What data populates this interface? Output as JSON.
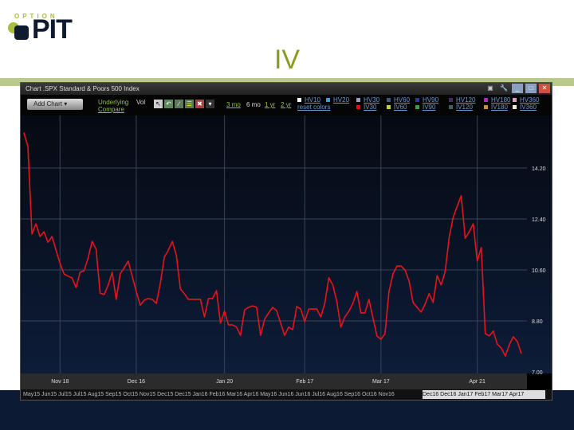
{
  "logo": {
    "top": "OPTION",
    "main": "PIT"
  },
  "slide_title": "IV",
  "window": {
    "title": "Chart  .SPX  Standard & Poors 500 Index",
    "buttons": [
      "camera",
      "wrench",
      "minimize",
      "maximize",
      "close"
    ],
    "add_chart": "Add Chart",
    "underlying": "Underlying",
    "vol": "Vol",
    "compare": "Compare",
    "ranges": [
      "3 mo",
      "6 mo",
      "1 yr",
      "2 yr"
    ],
    "legend_row1": [
      {
        "label": "HV10",
        "color": "#ffffff"
      },
      {
        "label": "HV20",
        "color": "#3aa0d0"
      },
      {
        "label": "HV30",
        "color": "#9aa0b8"
      },
      {
        "label": "HV60",
        "color": "#3a5a80"
      },
      {
        "label": "HV90",
        "color": "#3030c0"
      },
      {
        "label": "HV120",
        "color": "#403060"
      },
      {
        "label": "HV180",
        "color": "#c020c0"
      },
      {
        "label": "HV360",
        "color": "#e0a0c0"
      }
    ],
    "legend_row2": [
      {
        "label": "reset colors",
        "color": ""
      },
      {
        "label": "IV30",
        "color": "#e01010"
      },
      {
        "label": "IV60",
        "color": "#c0d040"
      },
      {
        "label": "IV90",
        "color": "#40a040"
      },
      {
        "label": "IV120",
        "color": "#406060"
      },
      {
        "label": "IV180",
        "color": "#d09030"
      },
      {
        "label": "IV360",
        "color": "#f0f0d0"
      }
    ],
    "navigator": "May15 Jun15 Jul15 Jul15 Aug15 Sep15 Oct15 Nov15 Dec15 Dec15 Jan16 Feb16 Mar16 Apr16 May16 Jun16 Jun16 Jul16 Aug16 Sep16 Oct16 Nov16",
    "navigator_selected": "Dec16 Dec16 Jan17 Feb17 Mar17 Apr17"
  },
  "chart_data": {
    "type": "line",
    "series": [
      {
        "name": "IV30",
        "color": "#e8141c",
        "values": [
          15.44,
          14.96,
          11.87,
          12.23,
          11.78,
          11.95,
          11.58,
          11.78,
          11.3,
          10.83,
          10.46,
          10.38,
          10.32,
          9.98,
          10.52,
          10.57,
          11.02,
          11.61,
          11.33,
          9.78,
          9.73,
          10.06,
          10.52,
          9.56,
          10.46,
          10.68,
          10.91,
          10.38,
          9.84,
          9.36,
          9.53,
          9.59,
          9.56,
          9.42,
          10.12,
          11.05,
          11.3,
          11.61,
          11.11,
          9.93,
          9.76,
          9.56,
          9.56,
          9.56,
          9.56,
          8.94,
          9.59,
          9.59,
          9.87,
          8.72,
          9.14,
          8.66,
          8.66,
          8.58,
          8.29,
          9.19,
          9.28,
          9.33,
          9.28,
          8.29,
          8.86,
          9.08,
          9.28,
          9.16,
          8.72,
          8.29,
          8.58,
          8.49,
          9.31,
          9.22,
          8.77,
          9.22,
          9.22,
          9.22,
          8.94,
          9.42,
          10.32,
          10.07,
          9.48,
          8.58,
          8.94,
          9.14,
          9.42,
          9.84,
          9.08,
          9.08,
          9.56,
          8.91,
          8.27,
          8.15,
          8.35,
          9.84,
          10.46,
          10.74,
          10.74,
          10.6,
          10.21,
          9.45,
          9.28,
          9.11,
          9.39,
          9.76,
          9.45,
          10.4,
          10.07,
          10.54,
          11.75,
          12.46,
          12.85,
          13.22,
          11.72,
          11.95,
          12.23,
          10.91,
          11.39,
          8.35,
          8.27,
          8.44,
          7.98,
          7.84,
          7.56,
          7.96,
          8.24,
          8.07,
          7.65
        ]
      }
    ],
    "x_ticks": [
      "Nov 18",
      "Dec 16",
      "Jan 20",
      "Feb 17",
      "Mar 17",
      "Apr 21"
    ],
    "x_tick_index": [
      9,
      28,
      50,
      70,
      89,
      113
    ],
    "y_ticks": [
      "14.20",
      "12.40",
      "10.60",
      "8.80",
      "7.00"
    ],
    "ylim": [
      7.0,
      16.6
    ],
    "grid": true
  }
}
